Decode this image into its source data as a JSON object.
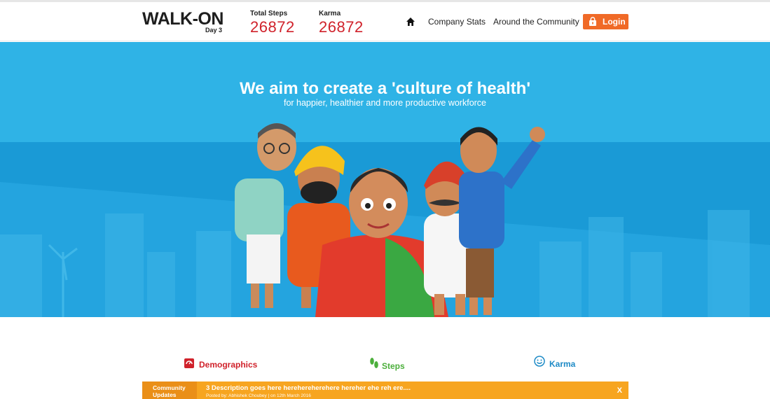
{
  "brand": {
    "logo_text": "WALK-ON",
    "day_label": "Day 3"
  },
  "stats": [
    {
      "label": "Total Steps",
      "value": "26872"
    },
    {
      "label": "Karma",
      "value": "26872"
    }
  ],
  "nav": {
    "home_icon": "home-icon",
    "company_stats": "Company Stats",
    "around_community": "Around the Community",
    "login": "Login"
  },
  "hero": {
    "title": "We aim to create a 'culture of health'",
    "subtitle": "for happier, healthier and more productive workforce"
  },
  "features": [
    {
      "label": "Demographics",
      "icon": "scale-icon",
      "color": "#d0222b"
    },
    {
      "label": "Steps",
      "icon": "footprints-icon",
      "color": "#4caf3c"
    },
    {
      "label": "Karma",
      "icon": "smiley-icon",
      "color": "#1d8ac6"
    }
  ],
  "updates": {
    "heading": "Community Updates",
    "message": "3 Description goes here herehereherehere hereher ehe reh ere....",
    "meta": "Posted by: Abhishek Choubey | on 12th March 2016",
    "close": "X"
  },
  "colors": {
    "accent": "#f06a27",
    "stat_value": "#d0222b",
    "hero_bg": "#2aace2",
    "updates_bg": "#f7a520"
  }
}
